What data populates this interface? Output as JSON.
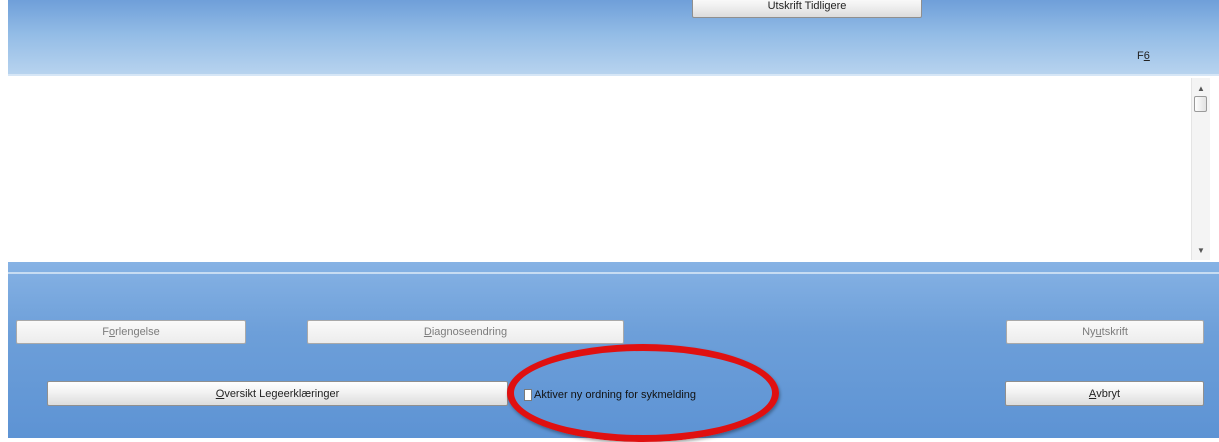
{
  "top": {
    "utskrift_tidligere_label": "Utskrift Tidligere",
    "f6_prefix": "F",
    "f6_key": "6"
  },
  "actions": {
    "forlengelse_pre": "F",
    "forlengelse_key": "o",
    "forlengelse_post": "rlengelse",
    "diagnoseendring_key": "D",
    "diagnoseendring_post": "iagnoseendring",
    "ny_utskrift_pre": "Ny ",
    "ny_utskrift_key": "u",
    "ny_utskrift_post": "tskrift",
    "oversikt_key": "O",
    "oversikt_post": "versikt Legeerklæringer",
    "avbryt_key": "A",
    "avbryt_post": "vbryt"
  },
  "checkbox": {
    "label": "Aktiver ny ordning for sykmelding",
    "checked": false
  },
  "scrollbar": {
    "up_icon": "▲",
    "down_icon": "▼"
  },
  "colors": {
    "panel_blue": "#6d9fd9",
    "highlight_red": "#e01010"
  }
}
